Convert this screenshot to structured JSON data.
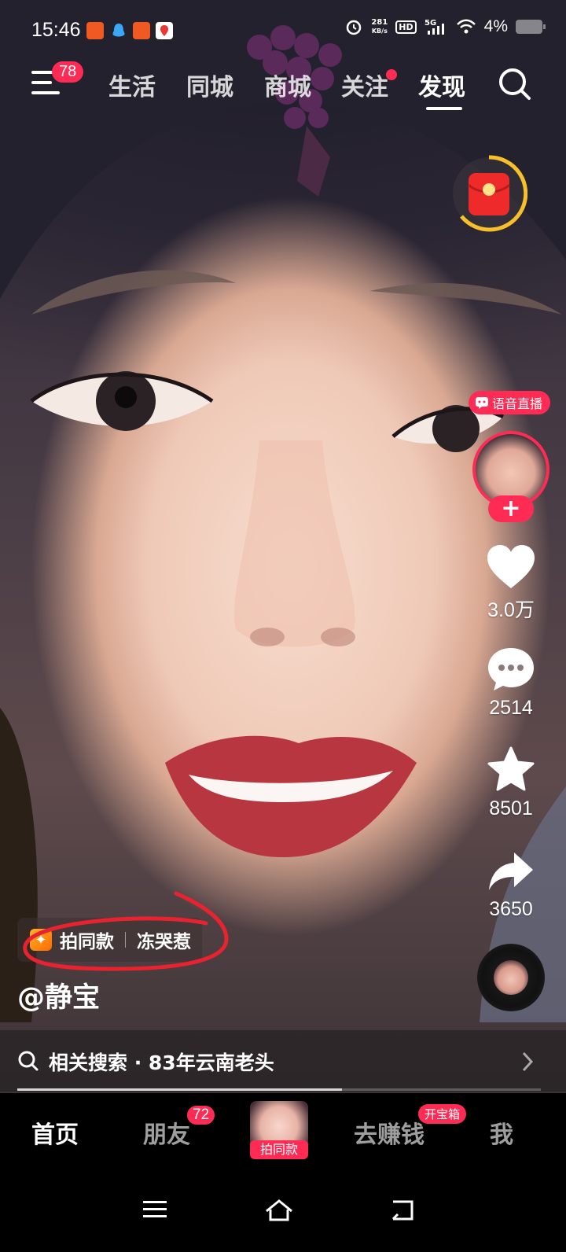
{
  "status_bar": {
    "time": "15:46",
    "net_speed_value": "281",
    "net_speed_unit": "KB/s",
    "hd_label": "HD",
    "network": "5G",
    "battery_percent": "4%"
  },
  "top_nav": {
    "menu_badge": "78",
    "tabs": [
      "生活",
      "同城",
      "商城",
      "关注",
      "发现"
    ],
    "active_tab": "发现",
    "follow_has_dot": true
  },
  "live": {
    "tag_label": "语音直播"
  },
  "actions": {
    "likes": "3.0万",
    "comments": "2514",
    "favorites": "8501",
    "shares": "3650"
  },
  "video": {
    "template_label": "拍同款",
    "template_name": "冻哭惹",
    "author": "@静宝",
    "related_search": "相关搜索 · 83年云南老头",
    "progress_fraction": 0.62
  },
  "bottom_tabs": {
    "home": "首页",
    "friends": "朋友",
    "friends_badge": "72",
    "create_label": "拍同款",
    "earn": "去赚钱",
    "earn_badge": "开宝箱",
    "me": "我"
  },
  "colors": {
    "accent": "#fe2c55",
    "annotation": "#e8232f"
  }
}
